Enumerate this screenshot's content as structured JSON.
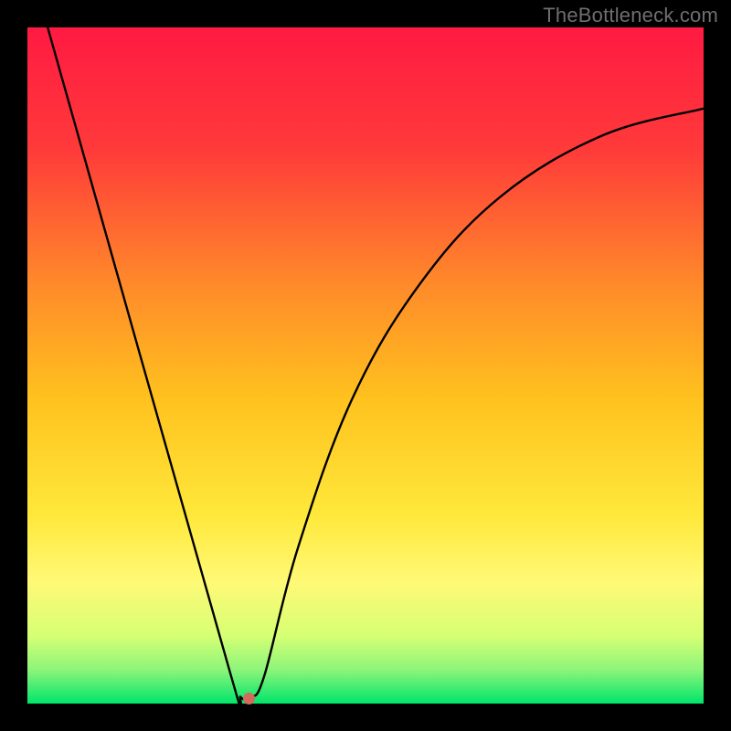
{
  "watermark": "TheBottleneck.com",
  "chart_data": {
    "type": "line",
    "title": "",
    "xlabel": "",
    "ylabel": "",
    "xlim": [
      0,
      100
    ],
    "ylim": [
      0,
      100
    ],
    "grid": false,
    "legend": false,
    "background_gradient": {
      "direction": "vertical",
      "stops": [
        {
          "offset": 0.0,
          "color": "#ff1a42"
        },
        {
          "offset": 0.18,
          "color": "#ff3a3a"
        },
        {
          "offset": 0.38,
          "color": "#ff8a2a"
        },
        {
          "offset": 0.55,
          "color": "#ffc21e"
        },
        {
          "offset": 0.72,
          "color": "#ffe83a"
        },
        {
          "offset": 0.82,
          "color": "#fff976"
        },
        {
          "offset": 0.9,
          "color": "#d6ff74"
        },
        {
          "offset": 0.95,
          "color": "#8cf57a"
        },
        {
          "offset": 1.0,
          "color": "#00e56a"
        }
      ]
    },
    "curve": {
      "stroke": "#000000",
      "stroke_width": 2.4,
      "points": [
        {
          "x": 3.0,
          "y": 100.0
        },
        {
          "x": 30.0,
          "y": 4.5
        },
        {
          "x": 31.5,
          "y": 1.0
        },
        {
          "x": 33.0,
          "y": 1.0
        },
        {
          "x": 35.0,
          "y": 4.0
        },
        {
          "x": 40.0,
          "y": 23.0
        },
        {
          "x": 48.0,
          "y": 45.0
        },
        {
          "x": 58.0,
          "y": 62.0
        },
        {
          "x": 70.0,
          "y": 75.0
        },
        {
          "x": 85.0,
          "y": 84.0
        },
        {
          "x": 100.0,
          "y": 88.0
        }
      ]
    },
    "marker": {
      "x": 32.8,
      "y": 0.8,
      "color": "#d46a5a",
      "radius_px": 6.5
    }
  }
}
